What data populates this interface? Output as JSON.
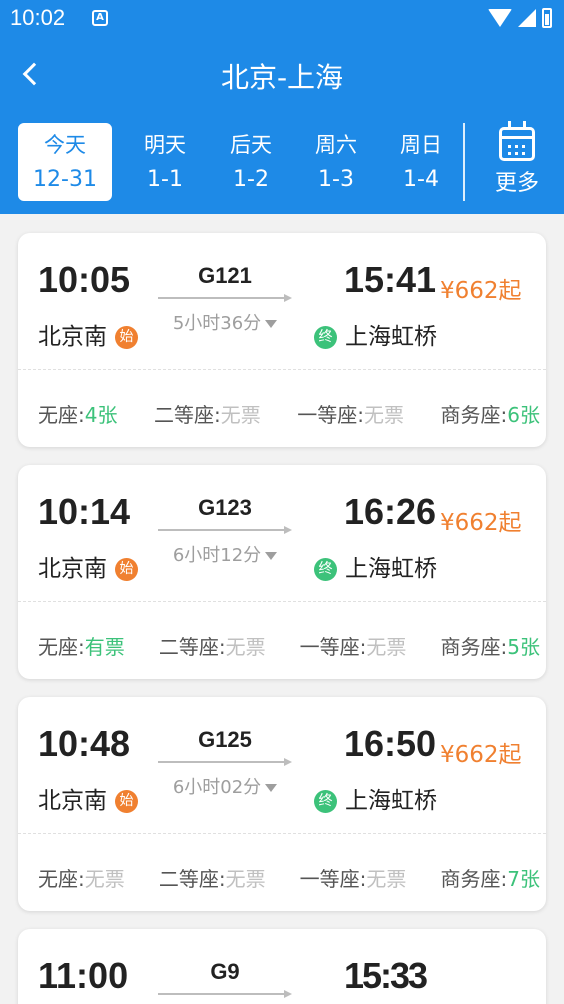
{
  "status_bar": {
    "time": "10:02",
    "app_badge": "A",
    "icons": [
      "wifi-icon",
      "signal-icon",
      "battery-icon"
    ]
  },
  "header": {
    "title": "北京-上海",
    "back_icon": "chevron-left-icon",
    "accent_color": "#1e8ae7"
  },
  "date_tabs": [
    {
      "label": "今天",
      "date": "12-31",
      "active": true
    },
    {
      "label": "明天",
      "date": "1-1"
    },
    {
      "label": "后天",
      "date": "1-2"
    },
    {
      "label": "周六",
      "date": "1-3"
    },
    {
      "label": "周日",
      "date": "1-4"
    }
  ],
  "more": {
    "label": "更多",
    "icon": "calendar-icon"
  },
  "trains": [
    {
      "dep_time": "10:05",
      "train_no": "G121",
      "arr_time": "15:41",
      "price": "¥662起",
      "duration": "5小时36分",
      "dep_station": "北京南",
      "start_badge": "始",
      "arr_station": "上海虹桥",
      "end_badge": "终",
      "seats": [
        {
          "name": "无座:",
          "value": "4张",
          "status": "has"
        },
        {
          "name": "二等座:",
          "value": "无票",
          "status": "none"
        },
        {
          "name": "一等座:",
          "value": "无票",
          "status": "none"
        },
        {
          "name": "商务座:",
          "value": "6张",
          "status": "has"
        }
      ]
    },
    {
      "dep_time": "10:14",
      "train_no": "G123",
      "arr_time": "16:26",
      "price": "¥662起",
      "duration": "6小时12分",
      "dep_station": "北京南",
      "start_badge": "始",
      "arr_station": "上海虹桥",
      "end_badge": "终",
      "seats": [
        {
          "name": "无座:",
          "value": "有票",
          "status": "has"
        },
        {
          "name": "二等座:",
          "value": "无票",
          "status": "none"
        },
        {
          "name": "一等座:",
          "value": "无票",
          "status": "none"
        },
        {
          "name": "商务座:",
          "value": "5张",
          "status": "has"
        }
      ]
    },
    {
      "dep_time": "10:48",
      "train_no": "G125",
      "arr_time": "16:50",
      "price": "¥662起",
      "duration": "6小时02分",
      "dep_station": "北京南",
      "start_badge": "始",
      "arr_station": "上海虹桥",
      "end_badge": "终",
      "seats": [
        {
          "name": "无座:",
          "value": "无票",
          "status": "none"
        },
        {
          "name": "二等座:",
          "value": "无票",
          "status": "none"
        },
        {
          "name": "一等座:",
          "value": "无票",
          "status": "none"
        },
        {
          "name": "商务座:",
          "value": "7张",
          "status": "has"
        }
      ]
    }
  ],
  "partial_train": {
    "dep_time": "11:00",
    "train_no": "G9",
    "arr_time": "15:33"
  }
}
